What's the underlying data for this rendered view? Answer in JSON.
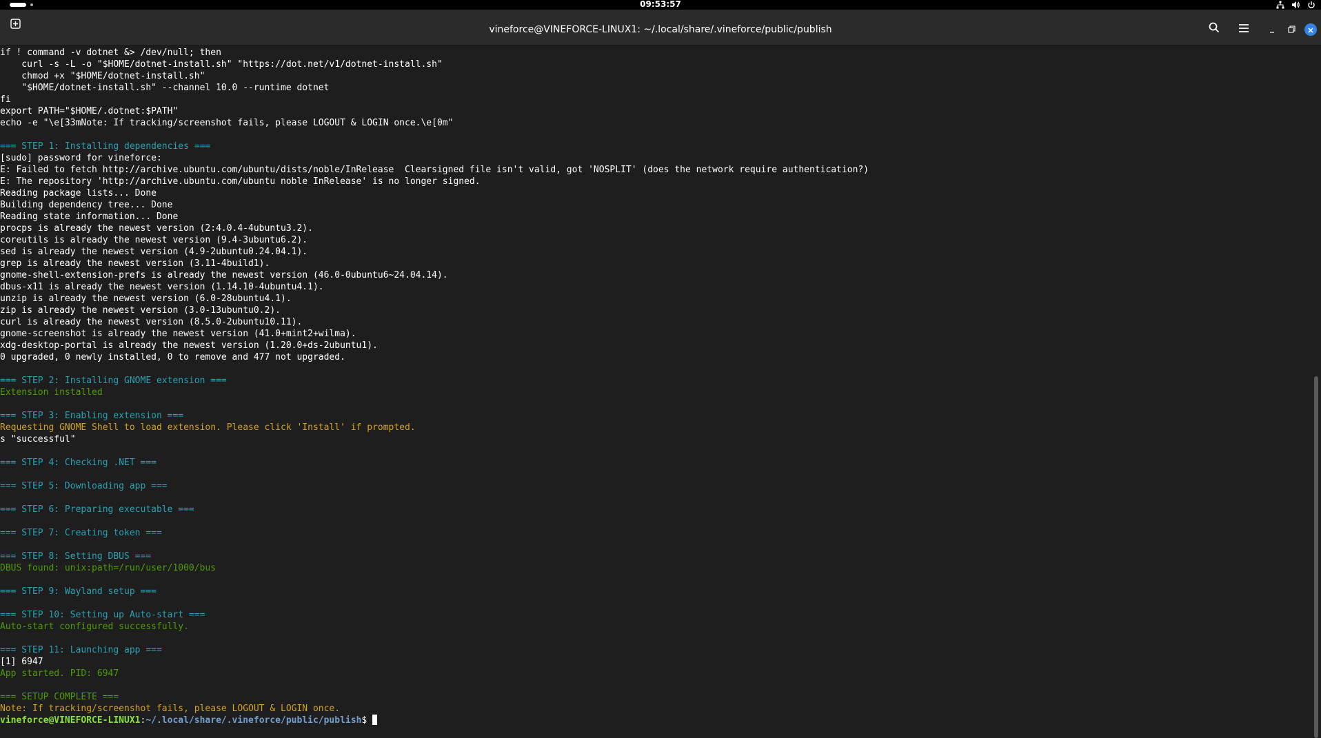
{
  "topbar": {
    "clock": "09:53:57",
    "icons": [
      "network-icon",
      "volume-icon",
      "power-icon"
    ]
  },
  "window": {
    "title": "vineforce@VINEFORCE-LINUX1: ~/.local/share/.vineforce/public/publish",
    "buttons": [
      "new-tab-icon",
      "search-icon",
      "menu-icon",
      "minimize-icon",
      "maximize-icon",
      "close-icon"
    ]
  },
  "colors": {
    "cyan": "#2aa1b3",
    "green": "#4e9a06",
    "yellow": "#d5a31a",
    "prompt_user": "#8ae234",
    "prompt_path": "#729fcf",
    "close_button": "#3584e4"
  },
  "terminal": {
    "lines": [
      {
        "t": "if ! command -v dotnet &> /dev/null; then",
        "c": "default"
      },
      {
        "t": "    curl -s -L -o \"$HOME/dotnet-install.sh\" \"https://dot.net/v1/dotnet-install.sh\"",
        "c": "default"
      },
      {
        "t": "    chmod +x \"$HOME/dotnet-install.sh\"",
        "c": "default"
      },
      {
        "t": "    \"$HOME/dotnet-install.sh\" --channel 10.0 --runtime dotnet",
        "c": "default"
      },
      {
        "t": "fi",
        "c": "default"
      },
      {
        "t": "export PATH=\"$HOME/.dotnet:$PATH\"",
        "c": "default"
      },
      {
        "t": "echo -e \"\\e[33mNote: If tracking/screenshot fails, please LOGOUT & LOGIN once.\\e[0m\"",
        "c": "default"
      },
      {
        "t": "",
        "c": "default"
      },
      {
        "t": "=== STEP 1: Installing dependencies ===",
        "c": "cyan"
      },
      {
        "t": "[sudo] password for vineforce:",
        "c": "default"
      },
      {
        "t": "E: Failed to fetch http://archive.ubuntu.com/ubuntu/dists/noble/InRelease  Clearsigned file isn't valid, got 'NOSPLIT' (does the network require authentication?)",
        "c": "default"
      },
      {
        "t": "E: The repository 'http://archive.ubuntu.com/ubuntu noble InRelease' is no longer signed.",
        "c": "default"
      },
      {
        "t": "Reading package lists... Done",
        "c": "default"
      },
      {
        "t": "Building dependency tree... Done",
        "c": "default"
      },
      {
        "t": "Reading state information... Done",
        "c": "default"
      },
      {
        "t": "procps is already the newest version (2:4.0.4-4ubuntu3.2).",
        "c": "default"
      },
      {
        "t": "coreutils is already the newest version (9.4-3ubuntu6.2).",
        "c": "default"
      },
      {
        "t": "sed is already the newest version (4.9-2ubuntu0.24.04.1).",
        "c": "default"
      },
      {
        "t": "grep is already the newest version (3.11-4build1).",
        "c": "default"
      },
      {
        "t": "gnome-shell-extension-prefs is already the newest version (46.0-0ubuntu6~24.04.14).",
        "c": "default"
      },
      {
        "t": "dbus-x11 is already the newest version (1.14.10-4ubuntu4.1).",
        "c": "default"
      },
      {
        "t": "unzip is already the newest version (6.0-28ubuntu4.1).",
        "c": "default"
      },
      {
        "t": "zip is already the newest version (3.0-13ubuntu0.2).",
        "c": "default"
      },
      {
        "t": "curl is already the newest version (8.5.0-2ubuntu10.11).",
        "c": "default"
      },
      {
        "t": "gnome-screenshot is already the newest version (41.0+mint2+wilma).",
        "c": "default"
      },
      {
        "t": "xdg-desktop-portal is already the newest version (1.20.0+ds-2ubuntu1).",
        "c": "default"
      },
      {
        "t": "0 upgraded, 0 newly installed, 0 to remove and 477 not upgraded.",
        "c": "default"
      },
      {
        "t": "",
        "c": "default"
      },
      {
        "t": "=== STEP 2: Installing GNOME extension ===",
        "c": "cyan"
      },
      {
        "t": "Extension installed",
        "c": "green"
      },
      {
        "t": "",
        "c": "default"
      },
      {
        "t": "=== STEP 3: Enabling extension ===",
        "c": "cyan"
      },
      {
        "t": "Requesting GNOME Shell to load extension. Please click 'Install' if prompted.",
        "c": "yellow"
      },
      {
        "t": "s \"successful\"",
        "c": "default"
      },
      {
        "t": "",
        "c": "default"
      },
      {
        "t": "=== STEP 4: Checking .NET ===",
        "c": "cyan"
      },
      {
        "t": "",
        "c": "default"
      },
      {
        "t": "=== STEP 5: Downloading app ===",
        "c": "cyan"
      },
      {
        "t": "",
        "c": "default"
      },
      {
        "t": "=== STEP 6: Preparing executable ===",
        "c": "cyan"
      },
      {
        "t": "",
        "c": "default"
      },
      {
        "t": "=== STEP 7: Creating token ===",
        "c": "cyan"
      },
      {
        "t": "",
        "c": "default"
      },
      {
        "t": "=== STEP 8: Setting DBUS ===",
        "c": "cyan"
      },
      {
        "t": "DBUS found: unix:path=/run/user/1000/bus",
        "c": "green"
      },
      {
        "t": "",
        "c": "default"
      },
      {
        "t": "=== STEP 9: Wayland setup ===",
        "c": "cyan"
      },
      {
        "t": "",
        "c": "default"
      },
      {
        "t": "=== STEP 10: Setting up Auto-start ===",
        "c": "cyan"
      },
      {
        "t": "Auto-start configured successfully.",
        "c": "green"
      },
      {
        "t": "",
        "c": "default"
      },
      {
        "t": "=== STEP 11: Launching app ===",
        "c": "cyan"
      },
      {
        "t": "[1] 6947",
        "c": "default"
      },
      {
        "t": "App started. PID: 6947",
        "c": "green"
      },
      {
        "t": "",
        "c": "default"
      },
      {
        "t": "=== SETUP COMPLETE ===",
        "c": "green"
      },
      {
        "t": "Note: If tracking/screenshot fails, please LOGOUT & LOGIN once.",
        "c": "yellow"
      }
    ],
    "prompt": {
      "user_host": "vineforce@VINEFORCE-LINUX1",
      "separator": ":",
      "path": "~/.local/share/.vineforce/public/publish",
      "symbol": "$ "
    }
  }
}
